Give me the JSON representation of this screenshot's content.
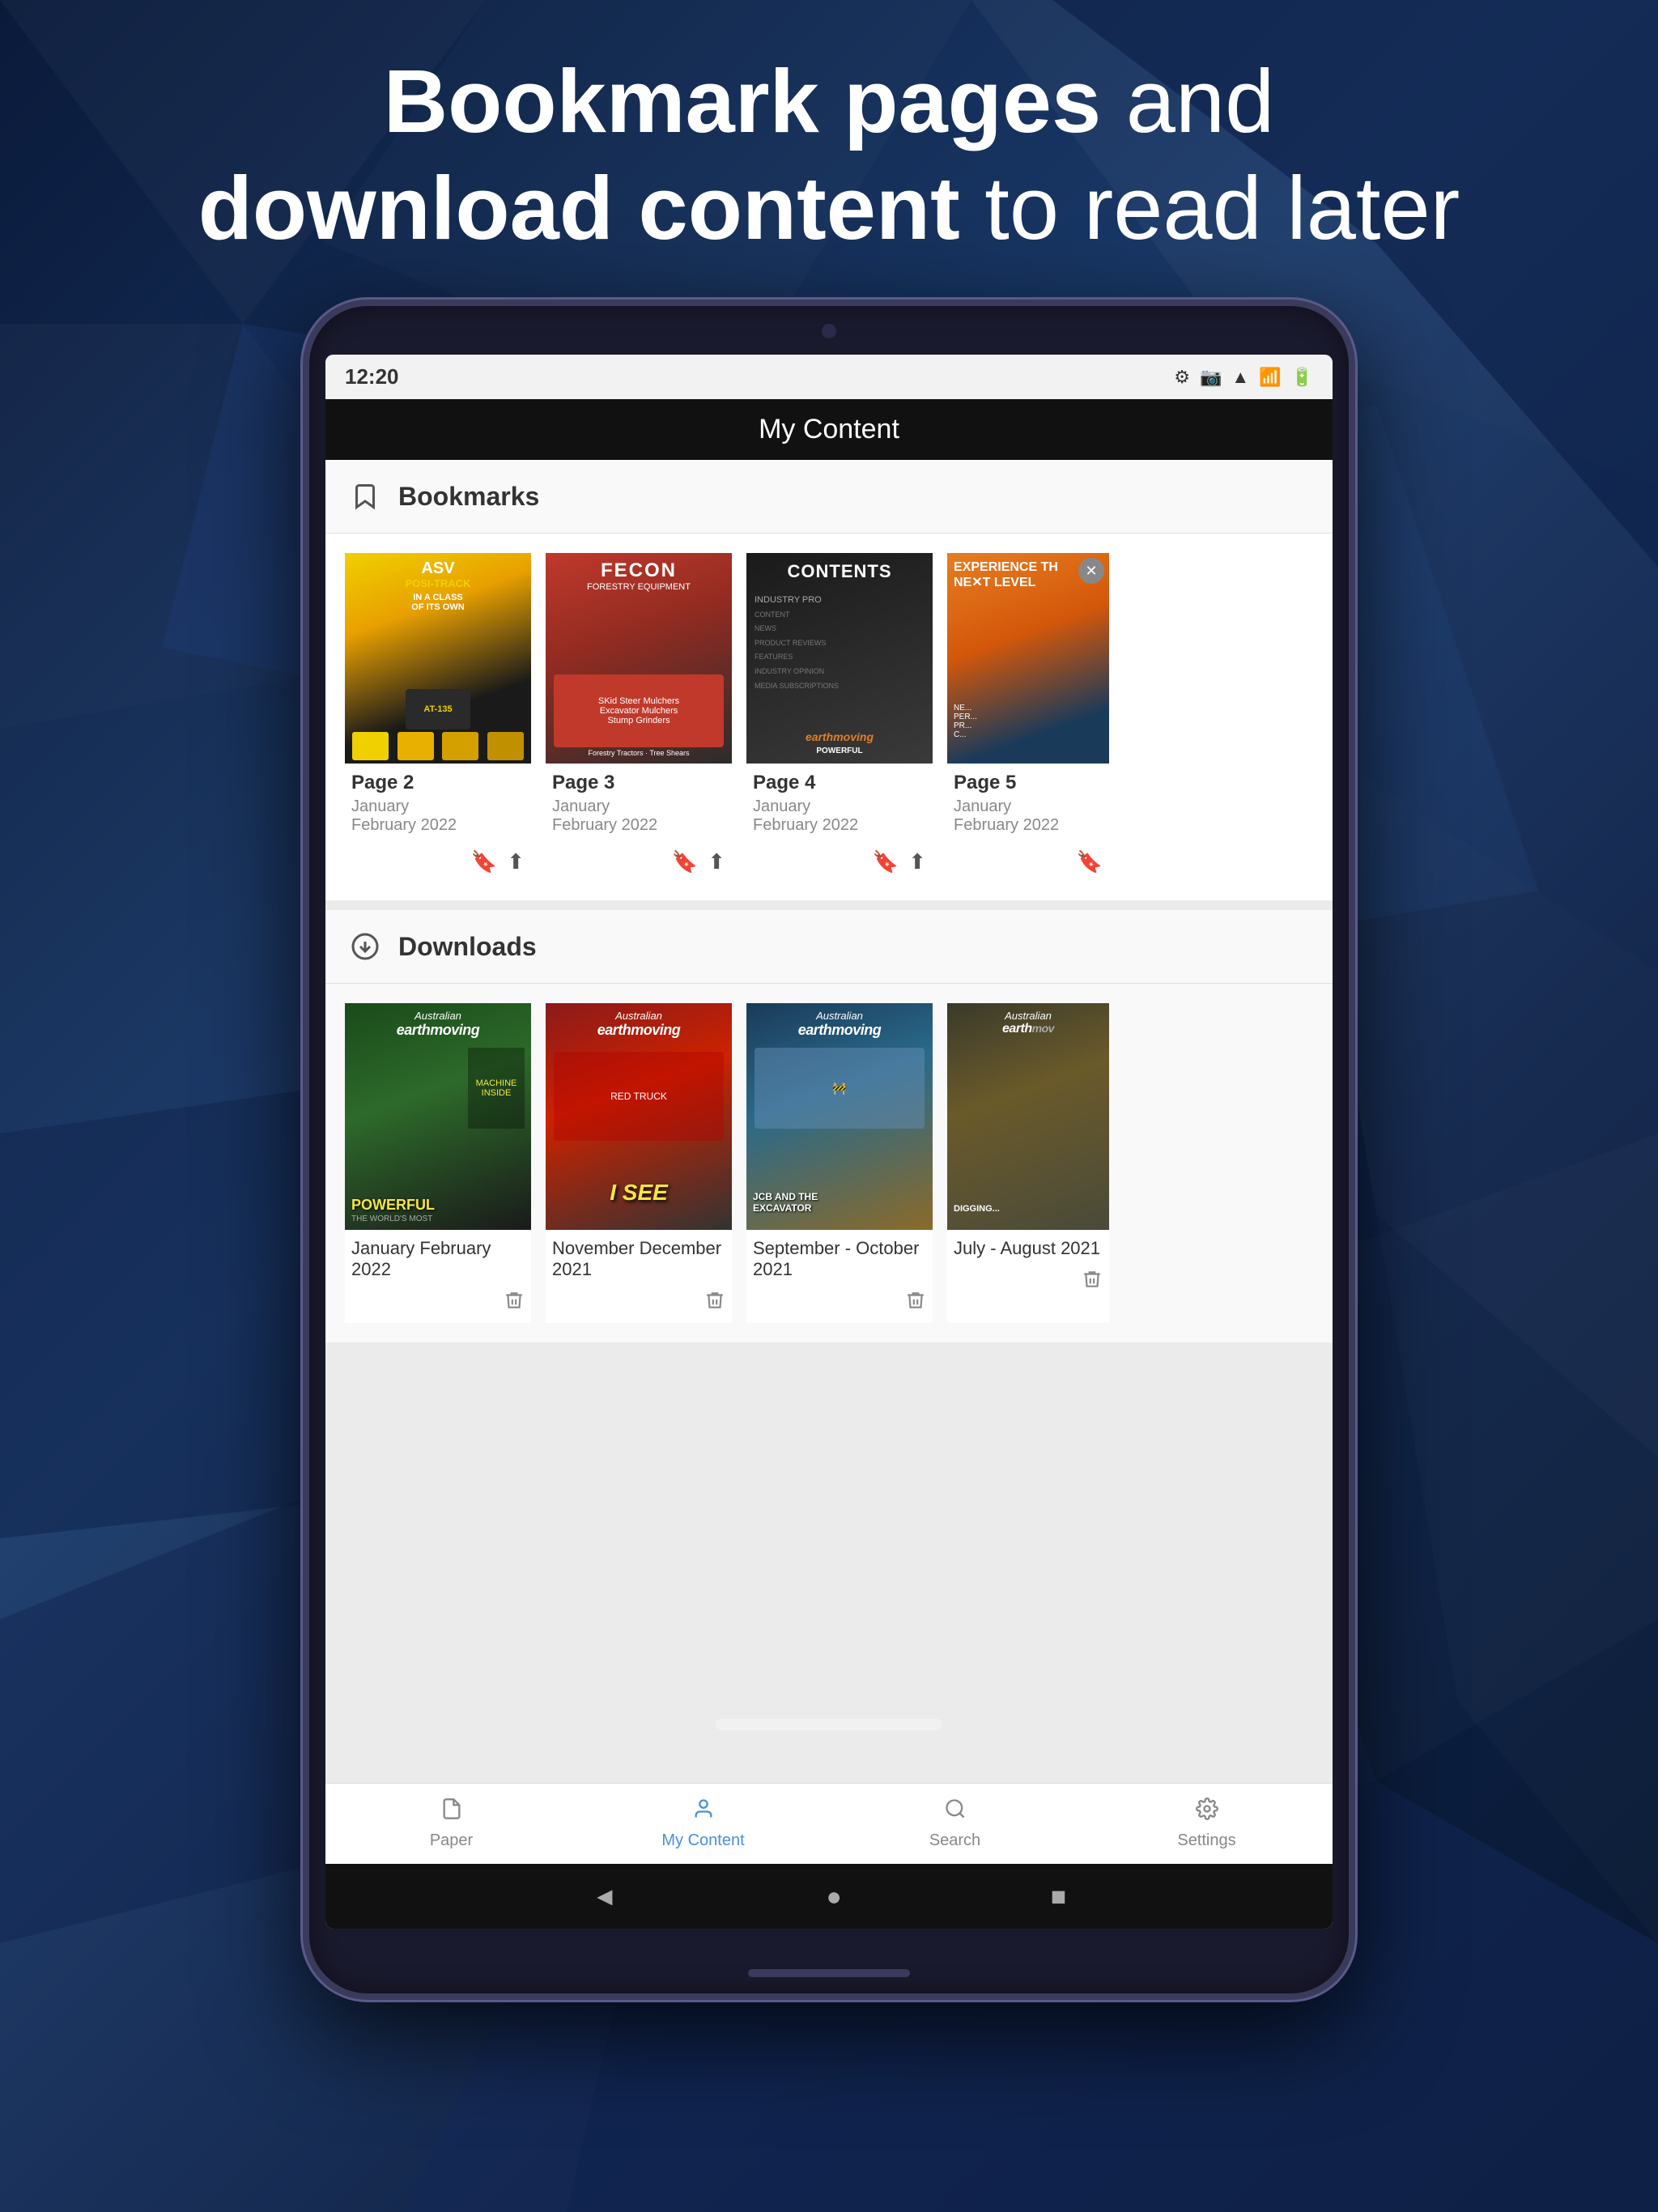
{
  "background": {
    "color": "#0d2147"
  },
  "headline": {
    "line1_bold": "Bookmark pages",
    "line1_normal": " and",
    "line2_bold": "download content",
    "line2_normal": " to read later"
  },
  "status_bar": {
    "time": "12:20",
    "icons": [
      "⚙",
      "📷",
      "▲",
      "📶",
      "🔋"
    ]
  },
  "app_header": {
    "title": "My Content"
  },
  "bookmarks": {
    "section_title": "Bookmarks",
    "items": [
      {
        "page": "Page 2",
        "date": "January\nFebruary 2022",
        "cover_type": "asv"
      },
      {
        "page": "Page 3",
        "date": "January\nFebruary 2022",
        "cover_type": "fecon"
      },
      {
        "page": "Page 4",
        "date": "January\nFebruary 2022",
        "cover_type": "contents"
      },
      {
        "page": "Page 5",
        "date": "January\nFebruary 2022",
        "cover_type": "earth4"
      }
    ]
  },
  "downloads": {
    "section_title": "Downloads",
    "items": [
      {
        "title": "January February 2022",
        "cover_type": "jan"
      },
      {
        "title": "November December 2021",
        "cover_type": "nov"
      },
      {
        "title": "September - October 2021",
        "cover_type": "sep"
      },
      {
        "title": "July - August 2021",
        "cover_type": "jul"
      }
    ]
  },
  "bottom_nav": {
    "items": [
      {
        "label": "Paper",
        "icon": "📄",
        "active": false
      },
      {
        "label": "My Content",
        "icon": "👤",
        "active": true
      },
      {
        "label": "Search",
        "icon": "🔍",
        "active": false
      },
      {
        "label": "Settings",
        "icon": "⚙",
        "active": false
      }
    ]
  }
}
